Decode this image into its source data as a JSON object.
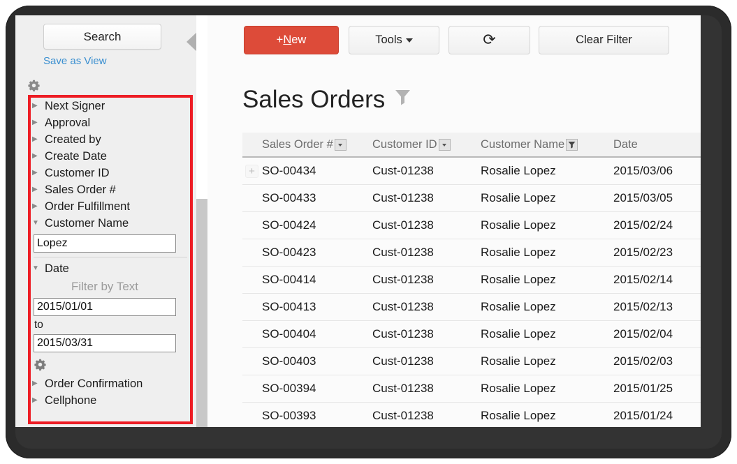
{
  "sidebar": {
    "search_button": "Search",
    "save_as_view": "Save as View",
    "gear_top_icon": "gear-icon",
    "gear_mid_icon": "gear-icon",
    "collapse_icon": "collapse-left-arrow-icon",
    "filters": [
      {
        "label": "Next Signer",
        "state": "collapsed"
      },
      {
        "label": "Approval",
        "state": "collapsed"
      },
      {
        "label": "Created by",
        "state": "collapsed"
      },
      {
        "label": "Create Date",
        "state": "collapsed"
      },
      {
        "label": "Customer ID",
        "state": "collapsed"
      },
      {
        "label": "Sales Order #",
        "state": "collapsed"
      },
      {
        "label": "Order Fulfillment",
        "state": "collapsed"
      },
      {
        "label": "Customer Name",
        "state": "expanded"
      },
      {
        "label": "Date",
        "state": "expanded"
      },
      {
        "label": "Order Confirmation",
        "state": "collapsed"
      },
      {
        "label": "Cellphone",
        "state": "collapsed"
      }
    ],
    "customer_name_value": "Lopez",
    "customer_name_placeholder": "",
    "date_filter": {
      "heading": "Filter by Text",
      "from_value": "2015/01/01",
      "to_label": "to",
      "to_value": "2015/03/31"
    }
  },
  "toolbar": {
    "new_label_plus": "+",
    "new_label_underline": "N",
    "new_label_rest": "ew",
    "tools_label": "Tools",
    "refresh_icon": "refresh-icon",
    "refresh_glyph": "⟳",
    "clear_filter_label": "Clear Filter"
  },
  "main": {
    "title": "Sales Orders",
    "title_filter_icon": "funnel-icon",
    "columns": [
      {
        "key": "sales_order",
        "label": "Sales Order #",
        "control": "dropdown"
      },
      {
        "key": "customer_id",
        "label": "Customer ID",
        "control": "dropdown"
      },
      {
        "key": "customer_name",
        "label": "Customer Name",
        "control": "filter-active"
      },
      {
        "key": "date",
        "label": "Date",
        "control": "none"
      }
    ],
    "expand_row_glyph": "+",
    "rows": [
      {
        "sales_order": "SO-00434",
        "customer_id": "Cust-01238",
        "customer_name": "Rosalie Lopez",
        "date": "2015/03/06",
        "expandable": true
      },
      {
        "sales_order": "SO-00433",
        "customer_id": "Cust-01238",
        "customer_name": "Rosalie Lopez",
        "date": "2015/03/05",
        "expandable": false
      },
      {
        "sales_order": "SO-00424",
        "customer_id": "Cust-01238",
        "customer_name": "Rosalie Lopez",
        "date": "2015/02/24",
        "expandable": false
      },
      {
        "sales_order": "SO-00423",
        "customer_id": "Cust-01238",
        "customer_name": "Rosalie Lopez",
        "date": "2015/02/23",
        "expandable": false
      },
      {
        "sales_order": "SO-00414",
        "customer_id": "Cust-01238",
        "customer_name": "Rosalie Lopez",
        "date": "2015/02/14",
        "expandable": false
      },
      {
        "sales_order": "SO-00413",
        "customer_id": "Cust-01238",
        "customer_name": "Rosalie Lopez",
        "date": "2015/02/13",
        "expandable": false
      },
      {
        "sales_order": "SO-00404",
        "customer_id": "Cust-01238",
        "customer_name": "Rosalie Lopez",
        "date": "2015/02/04",
        "expandable": false
      },
      {
        "sales_order": "SO-00403",
        "customer_id": "Cust-01238",
        "customer_name": "Rosalie Lopez",
        "date": "2015/02/03",
        "expandable": false
      },
      {
        "sales_order": "SO-00394",
        "customer_id": "Cust-01238",
        "customer_name": "Rosalie Lopez",
        "date": "2015/01/25",
        "expandable": false
      },
      {
        "sales_order": "SO-00393",
        "customer_id": "Cust-01238",
        "customer_name": "Rosalie Lopez",
        "date": "2015/01/24",
        "expandable": false
      }
    ]
  },
  "colors": {
    "accent_red": "#dd4b39",
    "highlight_box": "#ed1c24",
    "link_blue": "#3a8fd0",
    "sidebar_bg": "#efefef",
    "bezel": "#2b2b2b"
  }
}
